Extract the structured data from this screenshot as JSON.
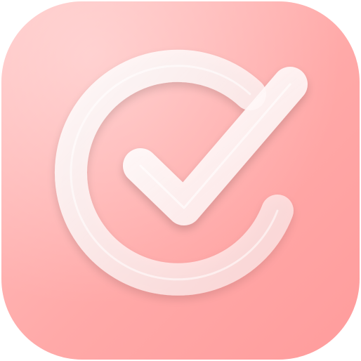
{
  "icon": {
    "name": "checkmark-circle-app-icon",
    "symbol": "check-circle-icon"
  },
  "colors": {
    "background_top": "#ffc2c1",
    "background_mid": "#ffa9a8",
    "background_bottom": "#ff9c9c",
    "glyph_fill": "#fff0f0",
    "glyph_edge": "#ffffff"
  }
}
